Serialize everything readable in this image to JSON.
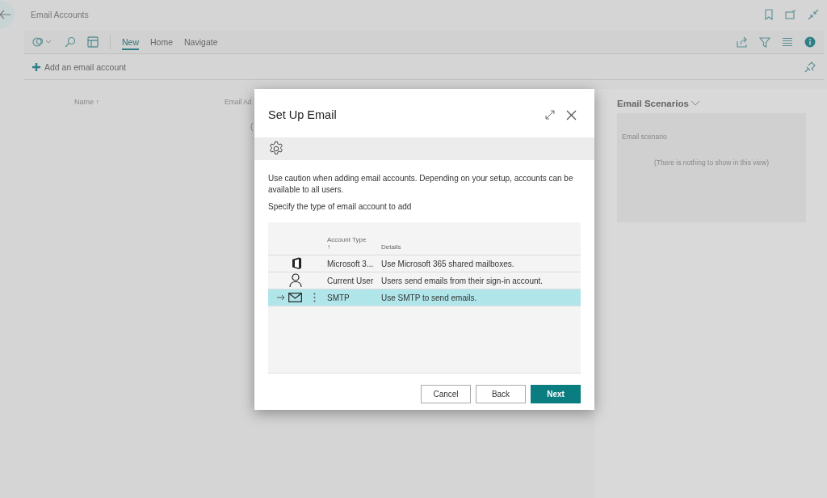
{
  "page": {
    "title": "Email Accounts"
  },
  "action_bar": {
    "tabs": [
      {
        "label": "New",
        "selected": true
      },
      {
        "label": "Home",
        "selected": false
      },
      {
        "label": "Navigate",
        "selected": false
      }
    ]
  },
  "actions": [
    {
      "label": "Add an email account"
    }
  ],
  "list": {
    "columns": [
      "Name ↑",
      "Email Ad"
    ],
    "empty_text": "("
  },
  "factbox": {
    "title": "Email Scenarios",
    "column": "Email scenario",
    "empty_text": "(There is nothing to show in this view)"
  },
  "dialog": {
    "title": "Set Up Email",
    "intro": "Use caution when adding email accounts. Depending on your setup, accounts can be available to all users.",
    "prompt": "Specify the type of email account to add",
    "table": {
      "columns": [
        "Account Type ↑",
        "Details"
      ],
      "rows": [
        {
          "kind": "office",
          "type": "Microsoft 3...",
          "details": "Use Microsoft 365 shared mailboxes.",
          "selected": false
        },
        {
          "kind": "user",
          "type": "Current User",
          "details": "Users send emails from their sign-in account.",
          "selected": false
        },
        {
          "kind": "mail",
          "type": "SMTP",
          "details": "Use SMTP to send emails.",
          "selected": true
        }
      ]
    },
    "buttons": [
      {
        "label": "Cancel",
        "kind": "secondary"
      },
      {
        "label": "Back",
        "kind": "secondary"
      },
      {
        "label": "Next",
        "kind": "primary"
      }
    ]
  }
}
